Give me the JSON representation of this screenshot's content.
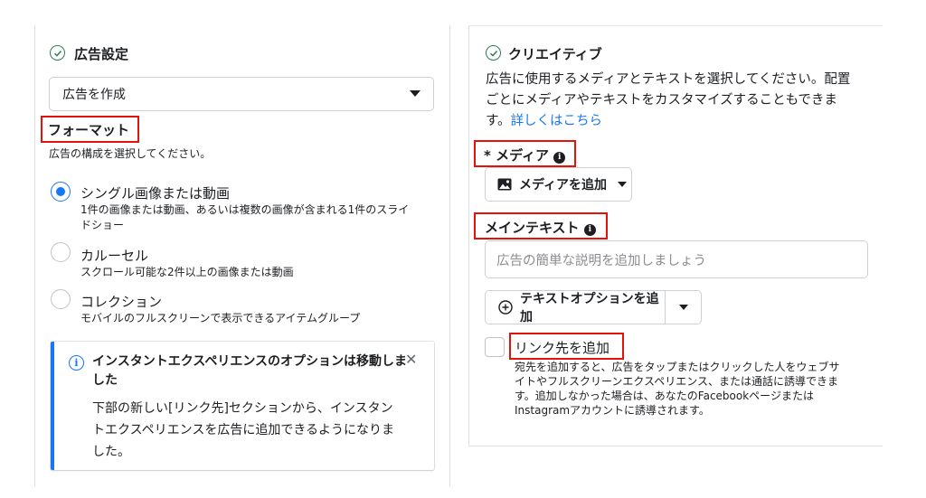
{
  "left": {
    "title": "広告設定",
    "select_value": "広告を作成",
    "format_heading": "フォーマット",
    "format_desc": "広告の構成を選択してください。",
    "options": [
      {
        "label": "シングル画像または動画",
        "desc_line1": "1件の画像または動画、あるいは複数の画像が含まれる1件のスライ",
        "desc_line2": "ドショー",
        "selected": true
      },
      {
        "label": "カルーセル",
        "desc_line1": "スクロール可能な2件以上の画像または動画",
        "selected": false
      },
      {
        "label": "コレクション",
        "desc_line1": "モバイルのフルスクリーンで表示できるアイテムグループ",
        "selected": false
      }
    ],
    "notice": {
      "title_line1": "インスタントエクスペリエンスのオプションは移動しま",
      "title_line2": "した",
      "body_line1": "下部の新しい[リンク先]セクションから、インスタン",
      "body_line2": "トエクスペリエンスを広告に追加できるようになりま",
      "body_line3": "した。",
      "close_glyph": "✕"
    }
  },
  "right": {
    "title": "クリエイティブ",
    "desc_line1": "広告に使用するメディアとテキストを選択してください。配置",
    "desc_line2": "ごとにメディアやテキストをカスタマイズすることもできま",
    "desc_line3_prefix": "す。",
    "learn_more": "詳しくはこちら",
    "media_label": "* メディア",
    "add_media_button": "メディアを追加",
    "primary_text_label": "メインテキスト",
    "primary_text_placeholder": "広告の簡単な説明を追加しましょう",
    "add_text_option_button": "テキストオプションを追加",
    "destination_label": "リンク先を追加",
    "destination_desc_line1": "宛先を追加すると、広告をタップまたはクリックした人をウェブサ",
    "destination_desc_line2": "イトやフルスクリーンエクスペリエンス、または通話に誘導できま",
    "destination_desc_line3": "す。追加しなかった場合は、あなたのFacebookページまたは",
    "destination_desc_line4": "Instagramアカウントに誘導されます。"
  },
  "icons": {
    "check": "check-circle-icon",
    "info": "info-icon",
    "image": "image-icon",
    "plus": "plus-circle-icon",
    "caret": "caret-down-icon",
    "close": "close-icon"
  },
  "colors": {
    "accent": "#1877f2",
    "highlight": "#e3120b",
    "success": "#2e7d52"
  }
}
